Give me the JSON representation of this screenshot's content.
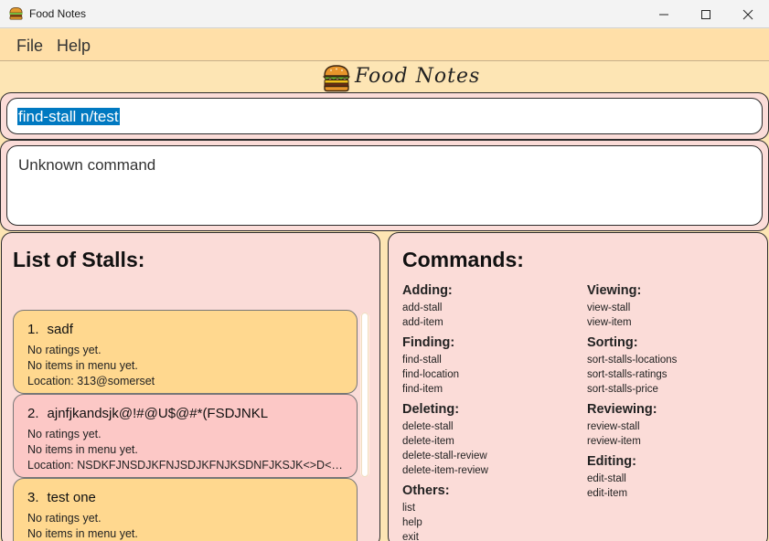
{
  "window": {
    "title": "Food Notes",
    "icon": "burger-icon"
  },
  "menu": {
    "file": "File",
    "help": "Help"
  },
  "brand": {
    "name": "Food Notes",
    "logo": "burger-icon"
  },
  "command_box": {
    "value": "find-stall n/test"
  },
  "result_display": {
    "text": "Unknown command"
  },
  "stall_panel": {
    "heading": "List of Stalls:",
    "stalls": [
      {
        "index": "1.",
        "name": "sadf",
        "rating": "No ratings yet.",
        "menu": "No items in menu yet.",
        "location": "Location: 313@somerset"
      },
      {
        "index": "2.",
        "name": "ajnfjkandsjk@!#@U$@#*(FSDJNKL",
        "rating": "No ratings yet.",
        "menu": "No items in menu yet.",
        "location": "Location: NSDKFJNSDJKFNJSDJKFNJKSDNFJKSJK<>D<S?F>..."
      },
      {
        "index": "3.",
        "name": "test one",
        "rating": "No ratings yet.",
        "menu": "No items in menu yet.",
        "location": ""
      }
    ]
  },
  "commands_panel": {
    "heading": "Commands:",
    "left_groups": [
      {
        "title": "Adding:",
        "items": [
          "add-stall",
          "add-item"
        ]
      },
      {
        "title": "Finding:",
        "items": [
          "find-stall",
          "find-location",
          "find-item"
        ]
      },
      {
        "title": "Deleting:",
        "items": [
          "delete-stall",
          "delete-item",
          "delete-stall-review",
          "delete-item-review"
        ]
      },
      {
        "title": "Others:",
        "items": [
          "list",
          "help",
          "exit"
        ]
      }
    ],
    "right_groups": [
      {
        "title": "Viewing:",
        "items": [
          "view-stall",
          "view-item"
        ]
      },
      {
        "title": "Sorting:",
        "items": [
          "sort-stalls-locations",
          "sort-stalls-ratings",
          "sort-stalls-price"
        ]
      },
      {
        "title": "Reviewing:",
        "items": [
          "review-stall",
          "review-item"
        ]
      },
      {
        "title": "Editing:",
        "items": [
          "edit-stall",
          "edit-item"
        ]
      }
    ]
  },
  "colors": {
    "menu_bg": "#ffdfa8",
    "panel_bg": "#fbdcd8",
    "card_odd": "#ffd88f",
    "card_even": "#fcc8c6",
    "selection": "#0079c1"
  }
}
